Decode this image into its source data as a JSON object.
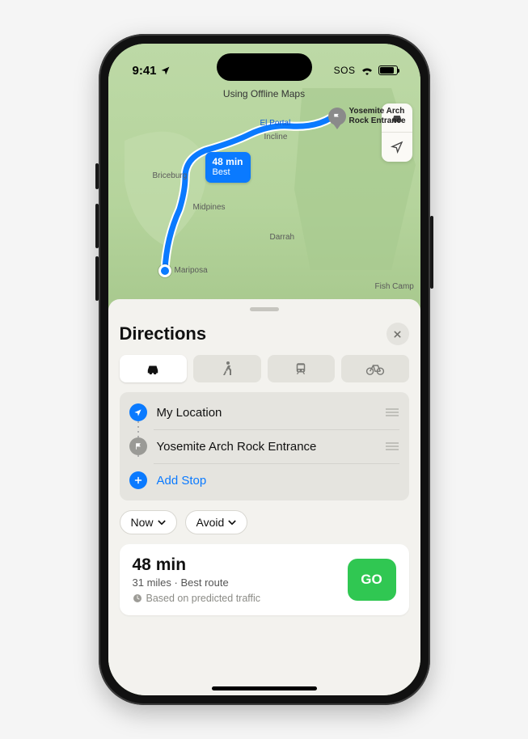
{
  "statusbar": {
    "time": "9:41",
    "sos": "SOS"
  },
  "map": {
    "offline_banner": "Using Offline Maps",
    "route_bubble": {
      "time": "48 min",
      "note": "Best"
    },
    "labels": {
      "dest": "Yosemite Arch\nRock Entrance",
      "elportal": "El Portal",
      "incline": "Incline",
      "briceburg": "Briceburg",
      "midpines": "Midpines",
      "darrah": "Darrah",
      "mariposa": "Mariposa",
      "fishcamp": "Fish Camp"
    }
  },
  "sheet": {
    "title": "Directions",
    "modes": [
      "drive",
      "walk",
      "transit",
      "cycle"
    ],
    "waypoints": {
      "origin": "My Location",
      "destination": "Yosemite Arch Rock Entrance",
      "add": "Add Stop"
    },
    "options": {
      "now": "Now",
      "avoid": "Avoid"
    },
    "route": {
      "time": "48 min",
      "distance_desc": "31 miles · Best route",
      "traffic_note": "Based on predicted traffic",
      "go": "GO"
    }
  }
}
